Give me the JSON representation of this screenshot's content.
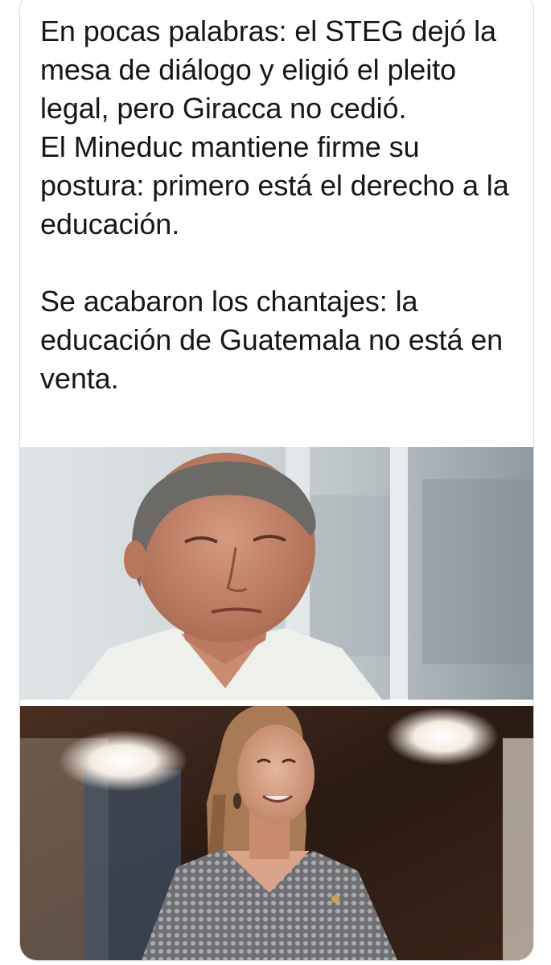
{
  "post": {
    "text": "En pocas palabras: el STEG dejó la mesa de diálogo y eligió el pleito legal, pero Giracca no cedió.\nEl Mineduc mantiene firme su postura: primero está el derecho a la educación.\n\nSe acabaron los chantajes: la educación de Guatemala no está en venta."
  },
  "media": {
    "images": [
      {
        "icon": "photo-man-white-shirt"
      },
      {
        "icon": "photo-woman-knit-sweater"
      }
    ]
  }
}
